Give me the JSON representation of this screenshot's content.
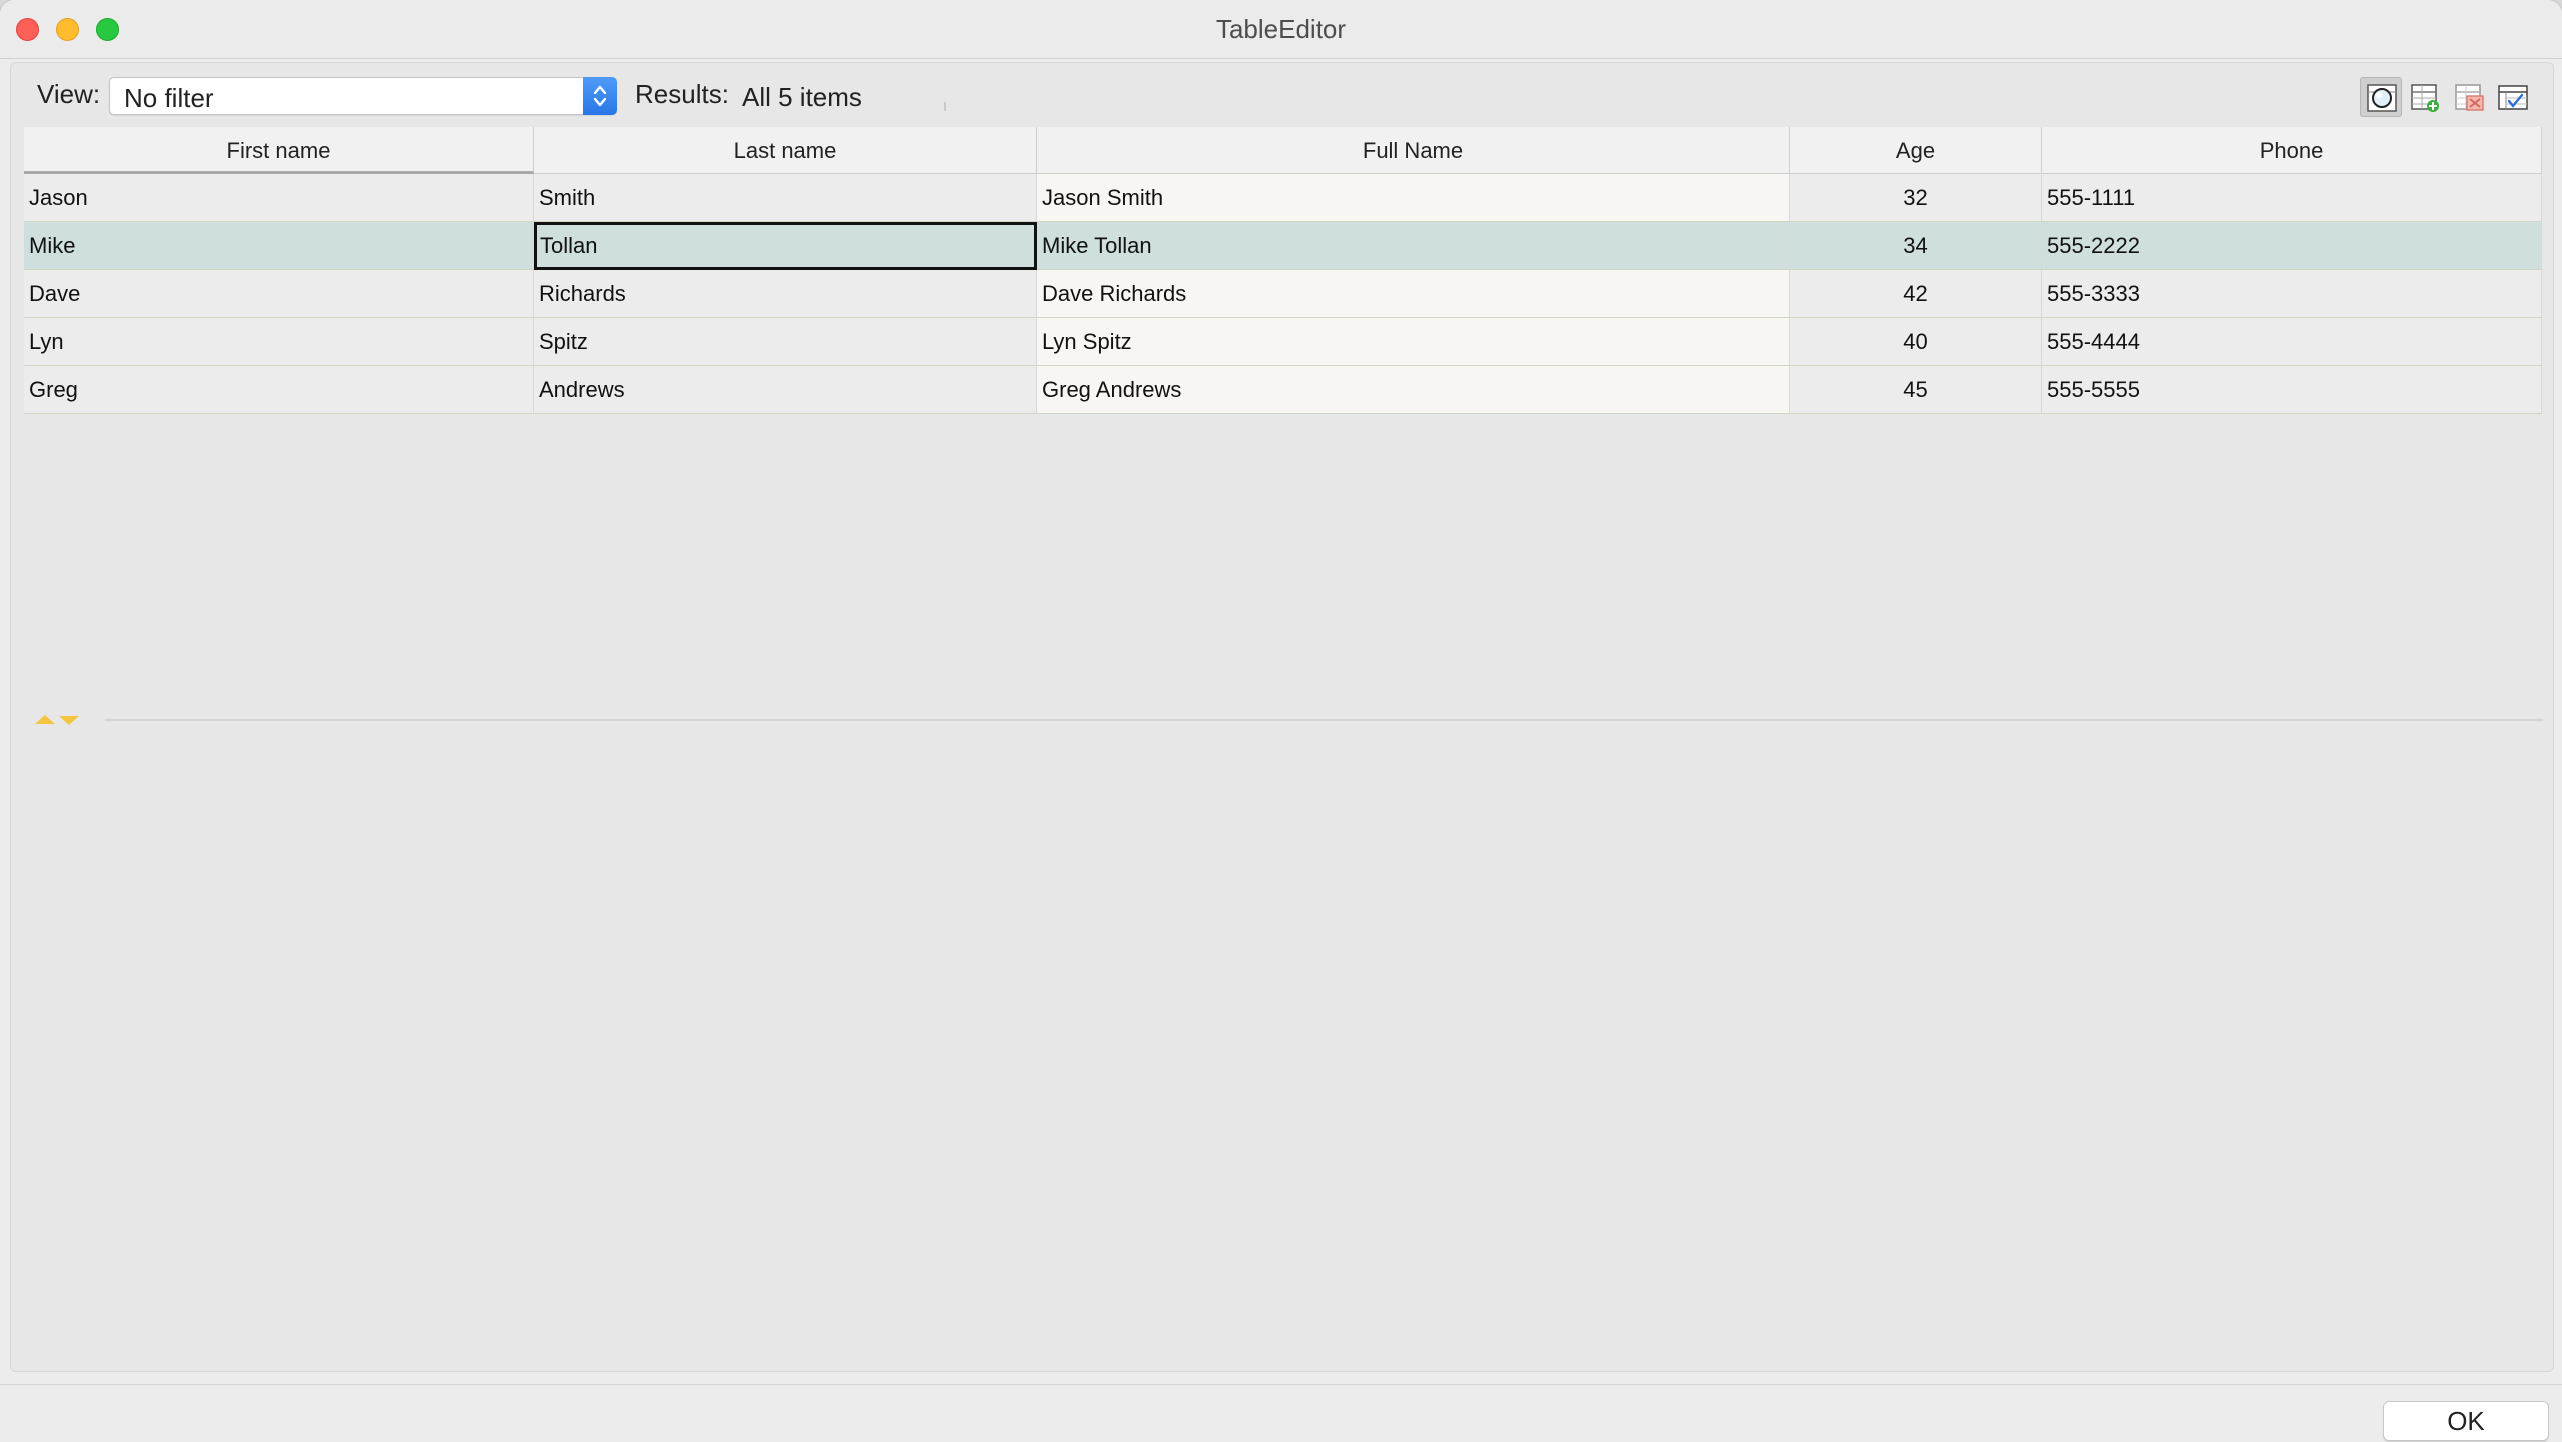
{
  "window": {
    "title": "TableEditor"
  },
  "toolbar": {
    "view_label": "View:",
    "filter_value": "No filter",
    "results_label": "Results:",
    "results_value": "All 5 items",
    "icons": [
      "search-table-icon",
      "add-row-icon",
      "delete-row-icon",
      "edit-table-icon"
    ]
  },
  "table": {
    "columns": [
      "First name",
      "Last name",
      "Full Name",
      "Age",
      "Phone"
    ],
    "rows": [
      [
        "Jason",
        "Smith",
        "Jason Smith",
        "32",
        "555-1111"
      ],
      [
        "Mike",
        "Tollan",
        "Mike Tollan",
        "34",
        "555-2222"
      ],
      [
        "Dave",
        "Richards",
        "Dave Richards",
        "42",
        "555-3333"
      ],
      [
        "Lyn",
        "Spitz",
        "Lyn Spitz",
        "40",
        "555-4444"
      ],
      [
        "Greg",
        "Andrews",
        "Greg Andrews",
        "45",
        "555-5555"
      ]
    ],
    "selected_row": 1,
    "focused_cell": "Last name"
  },
  "footer": {
    "ok_label": "OK"
  },
  "colors": {
    "selected_row": "#cfdfdd",
    "accent": "#2a76e6"
  }
}
